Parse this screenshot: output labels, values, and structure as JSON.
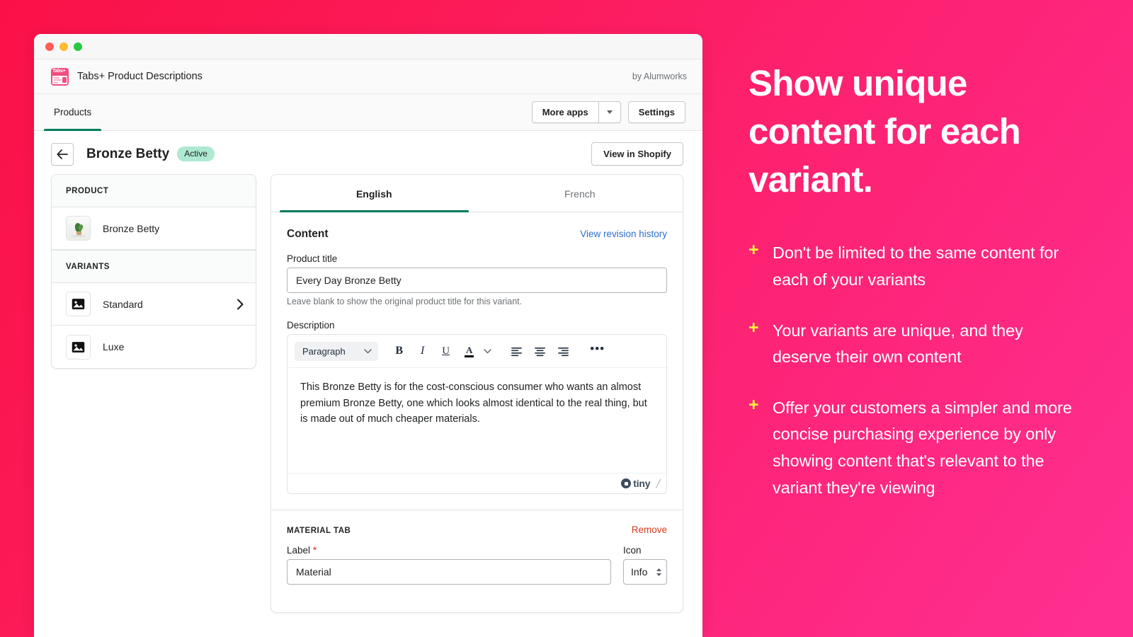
{
  "window": {
    "traffic_lights": [
      "close",
      "minimize",
      "zoom"
    ],
    "app_title": "Tabs+ Product Descriptions",
    "byline": "by Alumworks",
    "app_icon_word": "Tabs+"
  },
  "nav": {
    "tabs": [
      {
        "label": "Products",
        "active": true
      }
    ],
    "more_apps_label": "More apps",
    "settings_label": "Settings"
  },
  "page": {
    "title": "Bronze Betty",
    "status": "Active",
    "view_in_shopify_label": "View in Shopify",
    "back_icon": "arrow-left-icon"
  },
  "sidebar": {
    "product_section_label": "PRODUCT",
    "product_items": [
      {
        "label": "Bronze Betty"
      }
    ],
    "variants_section_label": "VARIANTS",
    "variant_items": [
      {
        "label": "Standard",
        "has_chevron": true
      },
      {
        "label": "Luxe",
        "has_chevron": false
      }
    ]
  },
  "main": {
    "language_tabs": [
      {
        "label": "English",
        "active": true
      },
      {
        "label": "French",
        "active": false
      }
    ],
    "content_section": {
      "title": "Content",
      "revision_link": "View revision history",
      "product_title_label": "Product title",
      "product_title_value": "Every Day Bronze Betty",
      "product_title_help": "Leave blank to show the original product title for this variant.",
      "description_label": "Description",
      "description_value": "This Bronze Betty is for the cost-conscious consumer who wants an almost premium Bronze Betty, one which looks almost identical to the real thing, but is made out of much cheaper materials."
    },
    "editor_toolbar": {
      "block_format": "Paragraph",
      "bold": "B",
      "italic": "I",
      "underline": "U",
      "text_color": "A",
      "align_left": "align-left",
      "align_center": "align-center",
      "align_right": "align-right",
      "more": "•••"
    },
    "editor_footer": {
      "brand": "tiny"
    },
    "material_tab": {
      "section_label": "MATERIAL TAB",
      "remove_label": "Remove",
      "label_field_label": "Label",
      "label_required_mark": "*",
      "label_value": "Material",
      "icon_field_label": "Icon",
      "icon_value": "Info"
    }
  },
  "promo": {
    "heading": "Show unique content for each variant.",
    "bullets": [
      "Don't be limited to the same content for each of your variants",
      "Your variants are unique, and they deserve their own content",
      "Offer your customers a simpler and more concise purchasing experience by only showing content that's relevant to the variant they're viewing"
    ],
    "bullet_marker": "+"
  },
  "colors": {
    "background_start": "#fa1147",
    "background_end": "#ff2f92",
    "accent_green": "#007b5c",
    "badge_green": "#aee9d1",
    "link_blue": "#2c6ecb",
    "remove_red": "#d93b1f",
    "plus_yellow": "#fff33d",
    "app_icon_pink": "#f24d7f"
  }
}
